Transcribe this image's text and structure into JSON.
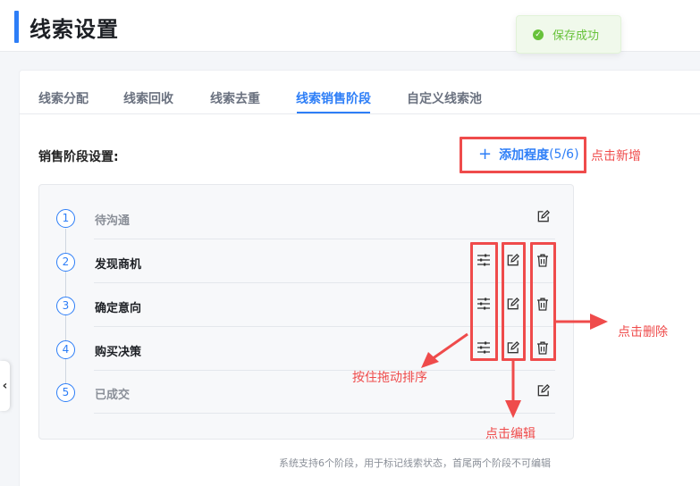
{
  "page": {
    "title": "线索设置"
  },
  "toast": {
    "icon": "check-circle-icon",
    "text": "保存成功"
  },
  "tabs": [
    {
      "label": "线索分配",
      "active": false
    },
    {
      "label": "线索回收",
      "active": false
    },
    {
      "label": "线索去重",
      "active": false
    },
    {
      "label": "线索销售阶段",
      "active": true
    },
    {
      "label": "自定义线索池",
      "active": false
    }
  ],
  "section": {
    "label": "销售阶段设置:",
    "add_button": {
      "label": "添加程度",
      "count": "(5/6)"
    }
  },
  "stages": [
    {
      "number": "1",
      "name": "待沟通",
      "editable": false
    },
    {
      "number": "2",
      "name": "发现商机",
      "editable": true
    },
    {
      "number": "3",
      "name": "确定意向",
      "editable": true
    },
    {
      "number": "4",
      "name": "购买决策",
      "editable": true
    },
    {
      "number": "5",
      "name": "已成交",
      "editable": false
    }
  ],
  "footnote": "系统支持6个阶段，用于标记线索状态，首尾两个阶段不可编辑",
  "annotations": {
    "add": "点击新增",
    "delete": "点击删除",
    "drag": "按住拖动排序",
    "edit": "点击编辑",
    "color": "#ef4b4b"
  },
  "colors": {
    "accent": "#2d7ef7",
    "success": "#67c23a"
  },
  "icons": {
    "drag": "sliders-icon",
    "edit": "edit-icon",
    "delete": "trash-icon",
    "back": "chevron-left-icon"
  }
}
